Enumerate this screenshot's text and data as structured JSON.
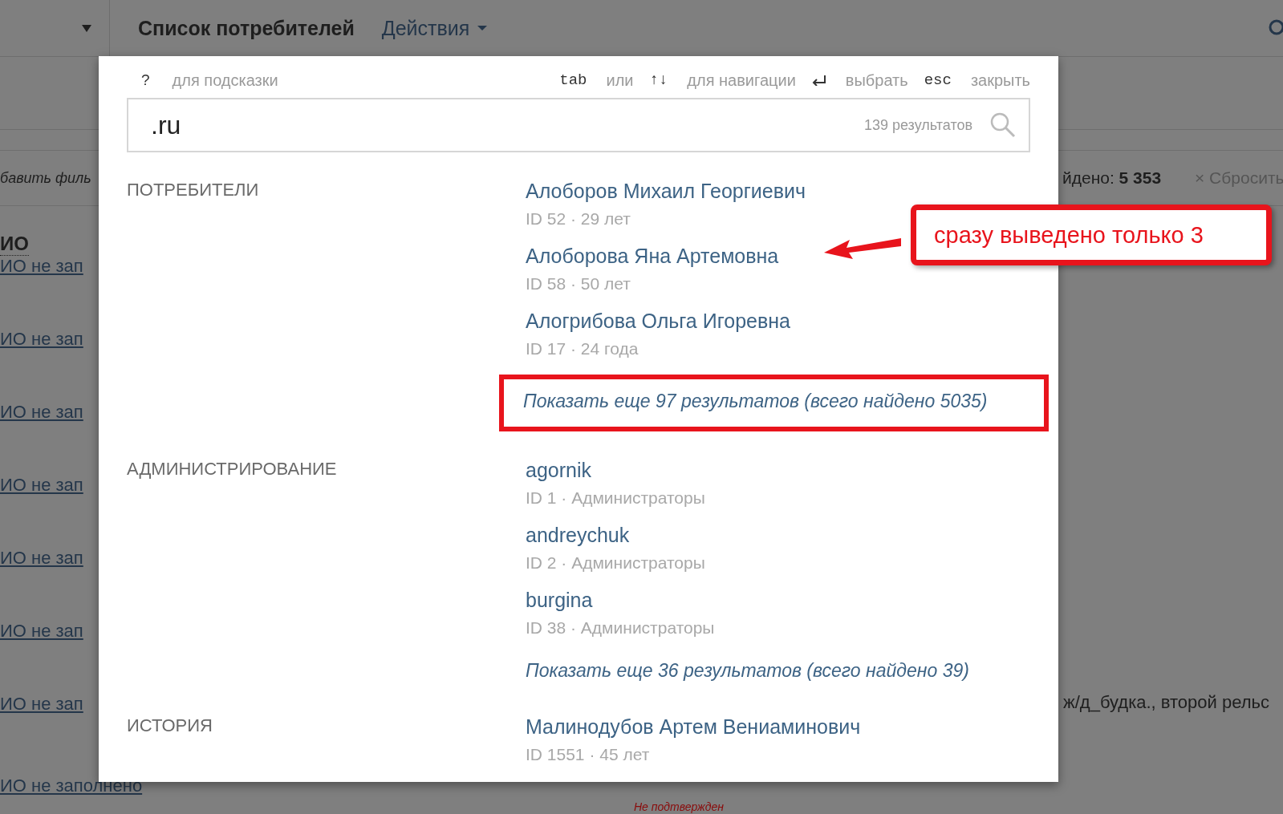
{
  "page": {
    "title": "Список потребителей",
    "actions_menu": "Действия",
    "filter_link": "бавить филь",
    "found_label": "йдено:",
    "found_count": "5 353",
    "reset": "× Сбросить",
    "column_1": "ИО",
    "rows": [
      {
        "name": "ИО не зап"
      },
      {
        "name": "ИО не зап"
      },
      {
        "name": "ИО не зап"
      },
      {
        "name": "ИО не зап"
      },
      {
        "name": "ИО не зап"
      },
      {
        "name": "ИО не зап"
      },
      {
        "name": "ИО не зап",
        "column_3": "ж/д_будка., второй рельс"
      },
      {
        "name": "ИО не заполнено",
        "status": "Не подтвержден"
      }
    ]
  },
  "search_dialog": {
    "hints": [
      {
        "key": "?",
        "text": "для подсказки"
      },
      {
        "key": "tab",
        "text": "или"
      },
      {
        "key": "↑↓",
        "text": "для навигации"
      },
      {
        "kind": "enter",
        "text": "выбрать"
      },
      {
        "key": "esc",
        "text": "закрыть"
      }
    ],
    "query": ".ru",
    "result_count": "139 результатов",
    "sections": [
      {
        "title": "ПОТРЕБИТЕЛИ",
        "items": [
          {
            "name": "Алоборов Михаил Георгиевич",
            "meta": "ID 52 · 29 лет"
          },
          {
            "name": "Алоборова Яна Артемовна",
            "meta": "ID 58 · 50 лет"
          },
          {
            "name": "Алогрибова Ольга Игоревна",
            "meta": "ID 17 · 24 года"
          }
        ],
        "more": {
          "text": "Показать еще 97 результатов (всего найдено 5035)",
          "highlighted": true
        }
      },
      {
        "title": "АДМИНИСТРИРОВАНИЕ",
        "items": [
          {
            "name": "agornik",
            "meta": "ID 1 · Администраторы"
          },
          {
            "name": "andreychuk",
            "meta": "ID 2 · Администраторы"
          },
          {
            "name": "burgina",
            "meta": "ID 38 · Администраторы"
          }
        ],
        "more": {
          "text": "Показать еще 36 результатов (всего найдено 39)",
          "highlighted": false
        }
      },
      {
        "title": "ИСТОРИЯ",
        "items": [
          {
            "name": "Малинодубов Артем Вениаминович",
            "meta": "ID 1551 · 45 лет"
          }
        ]
      }
    ]
  },
  "annotations": [
    {
      "kind": "callout",
      "text": "сразу выведено только 3"
    }
  ]
}
